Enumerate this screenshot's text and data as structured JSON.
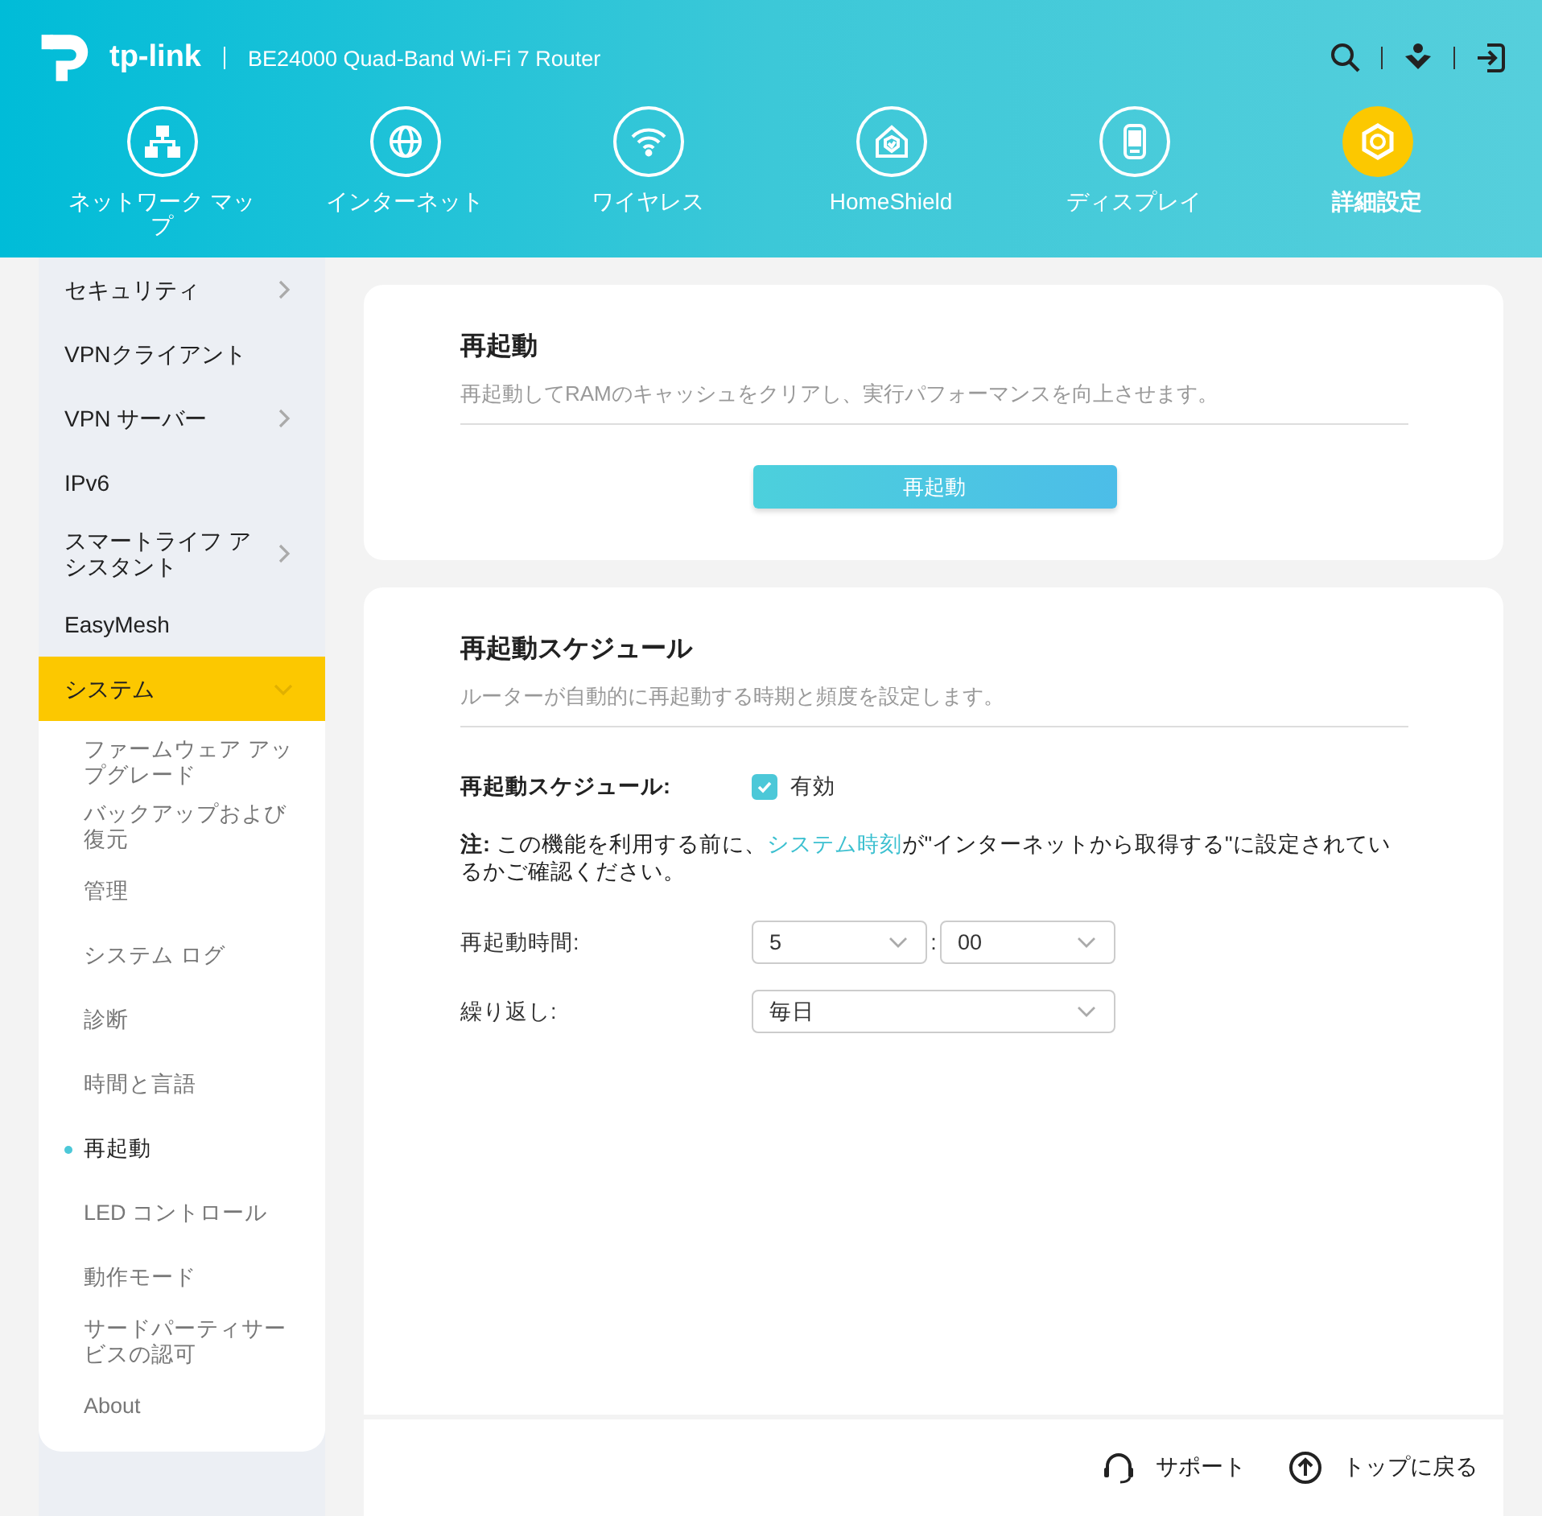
{
  "header": {
    "brand": "tp-link",
    "model": "BE24000 Quad-Band Wi-Fi 7 Router",
    "nav": [
      {
        "label": "ネットワーク マップ",
        "selected": false
      },
      {
        "label": "インターネット",
        "selected": false
      },
      {
        "label": "ワイヤレス",
        "selected": false
      },
      {
        "label": "HomeShield",
        "selected": false
      },
      {
        "label": "ディスプレイ",
        "selected": false
      },
      {
        "label": "詳細設定",
        "selected": true
      }
    ]
  },
  "sidebar": {
    "items": [
      {
        "label": "セキュリティ",
        "kind": "group",
        "expanded": false,
        "selected": false
      },
      {
        "label": "VPNクライアント",
        "kind": "link",
        "selected": false
      },
      {
        "label": "VPN サーバー",
        "kind": "group",
        "expanded": false,
        "selected": false
      },
      {
        "label": "IPv6",
        "kind": "link",
        "selected": false
      },
      {
        "label": "スマートライフ アシスタント",
        "kind": "group",
        "expanded": false,
        "selected": false
      },
      {
        "label": "EasyMesh",
        "kind": "link",
        "selected": false
      },
      {
        "label": "システム",
        "kind": "group",
        "expanded": true,
        "selected": true,
        "children": [
          {
            "label": "ファームウェア アップグレード",
            "selected": false
          },
          {
            "label": "バックアップおよび復元",
            "selected": false
          },
          {
            "label": "管理",
            "selected": false
          },
          {
            "label": "システム ログ",
            "selected": false
          },
          {
            "label": "診断",
            "selected": false
          },
          {
            "label": "時間と言語",
            "selected": false
          },
          {
            "label": "再起動",
            "selected": true
          },
          {
            "label": "LED コントロール",
            "selected": false
          },
          {
            "label": "動作モード",
            "selected": false
          },
          {
            "label": "サードパーティサービスの認可",
            "selected": false
          },
          {
            "label": "About",
            "selected": false
          }
        ]
      }
    ]
  },
  "reboot": {
    "title": "再起動",
    "description": "再起動してRAMのキャッシュをクリアし、実行パフォーマンスを向上させます。",
    "button": "再起動"
  },
  "schedule": {
    "title": "再起動スケジュール",
    "description": "ルーターが自動的に再起動する時期と頻度を設定します。",
    "enable_label": "再起動スケジュール:",
    "enable_checked": true,
    "enable_text": "有効",
    "note_before": "**注:** この機能を利用する前に、",
    "note_link": "システム時刻",
    "note_after": "が\"インターネットから取得する\"に設定されているかご確認ください。",
    "time_label": "再起動時間:",
    "hour": "5",
    "separator": ":",
    "minute": "00",
    "repeat_label": "繰り返し:",
    "repeat": "毎日"
  },
  "footer": {
    "support": "サポート",
    "back_to_top": "トップに戻る"
  }
}
